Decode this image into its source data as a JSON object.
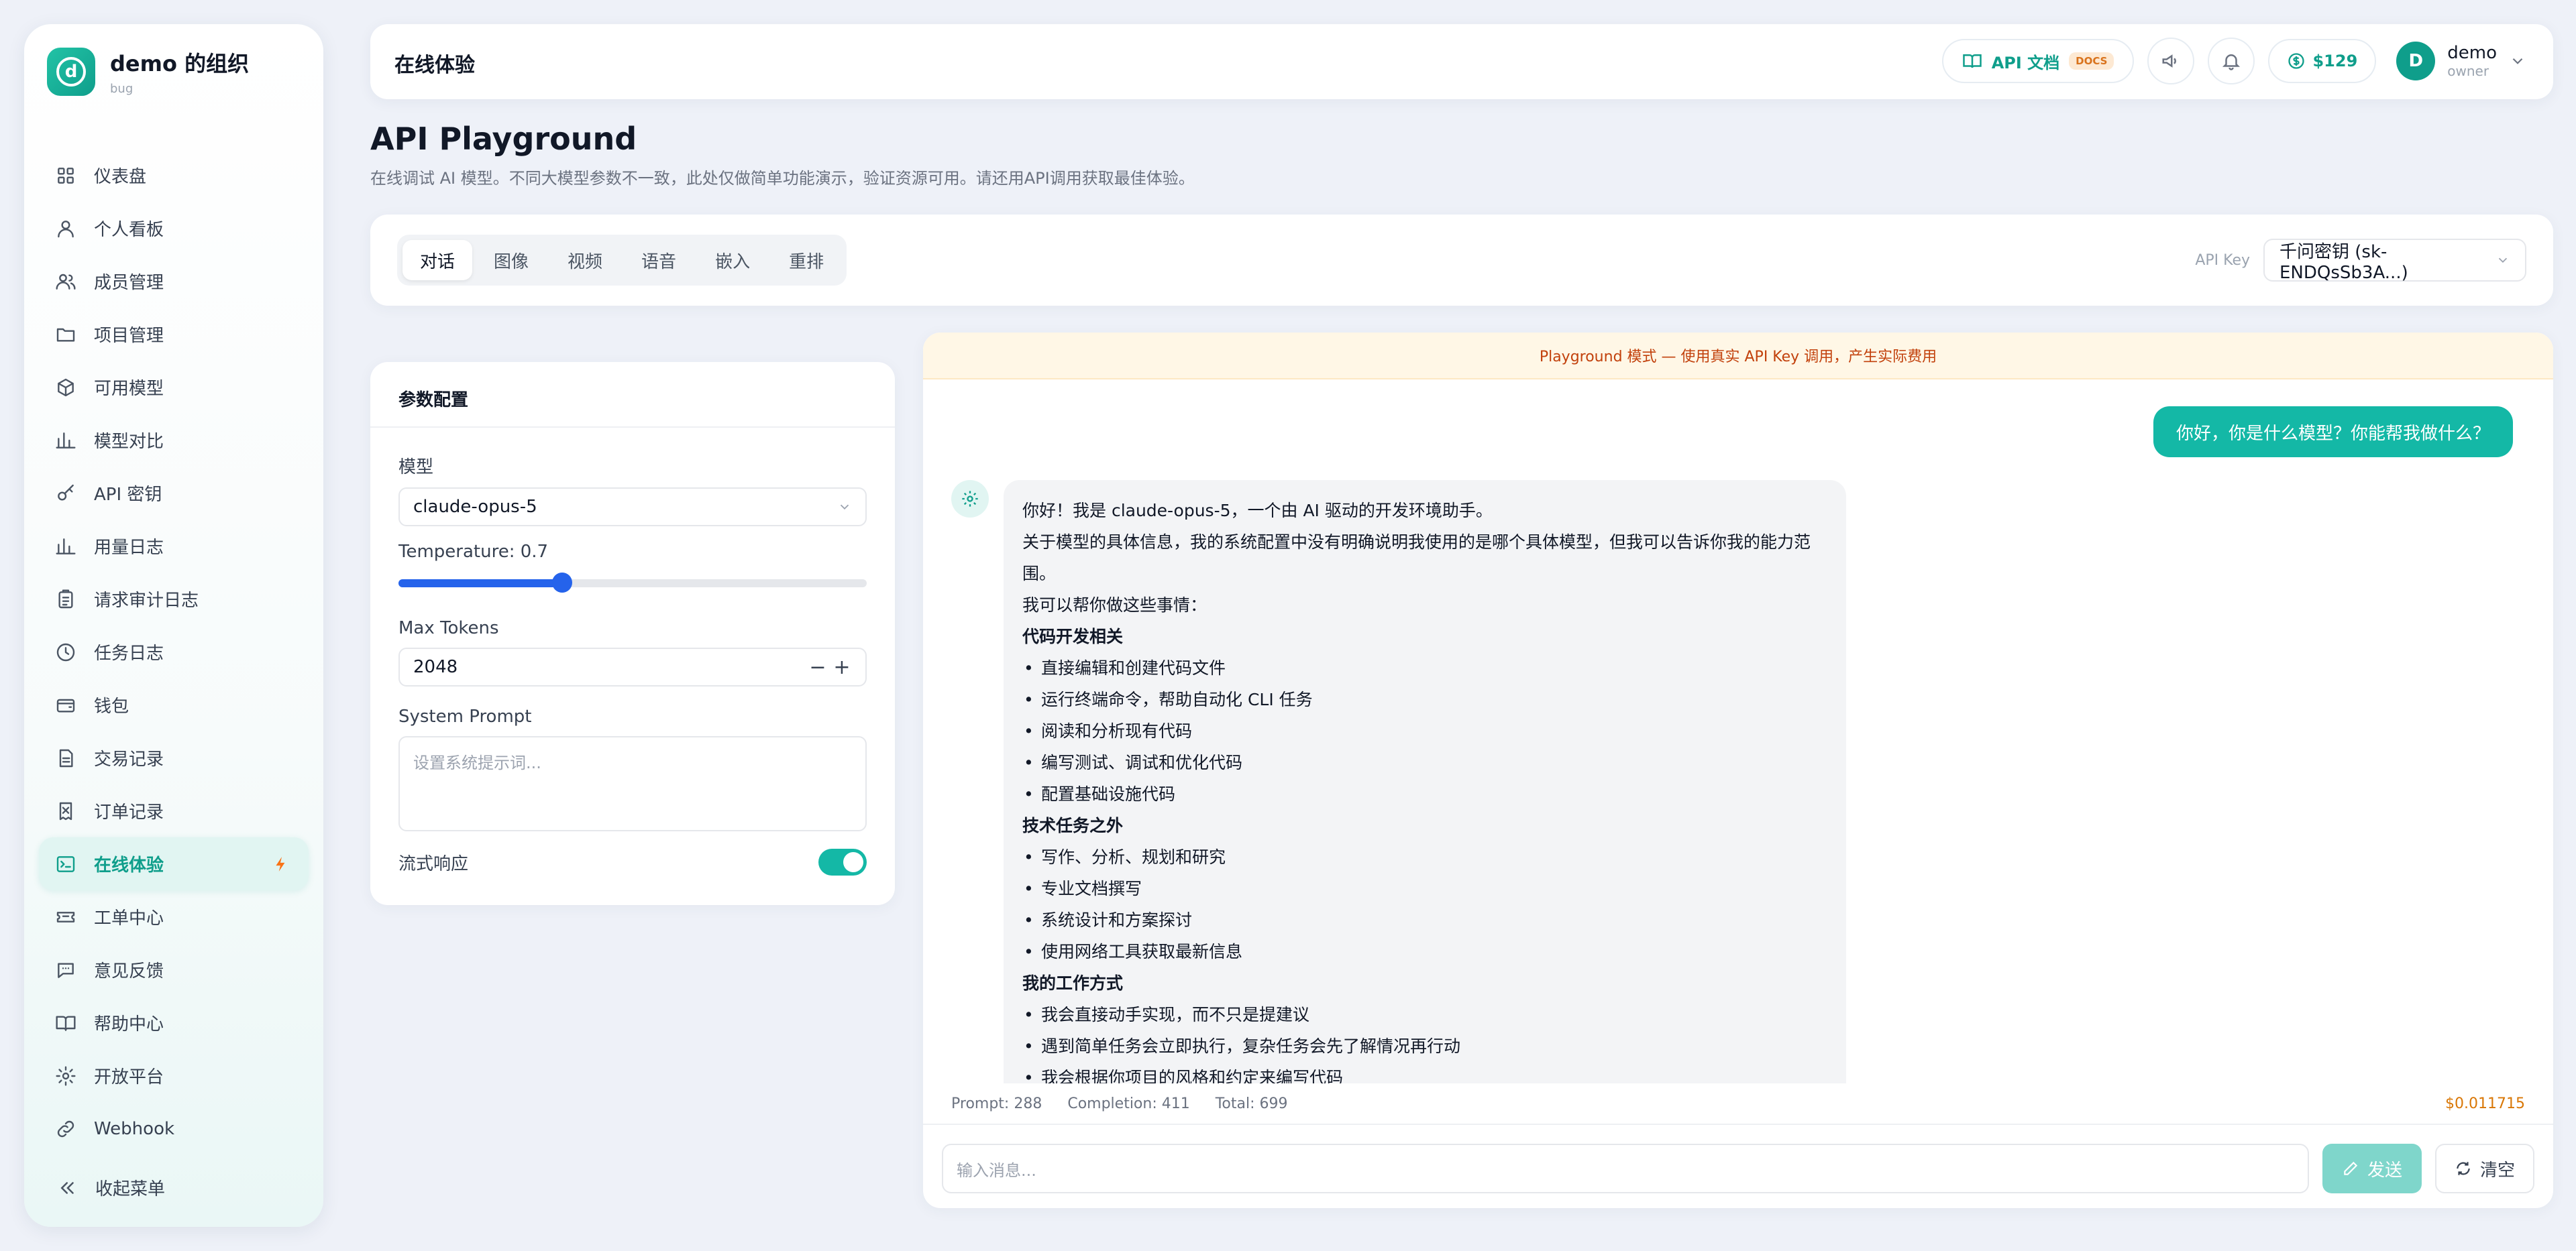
{
  "org": {
    "name": "demo 的组织",
    "subtitle": "bug",
    "logo_letter": "d"
  },
  "sidebar": {
    "items": [
      {
        "label": "仪表盘",
        "icon": "dashboard-icon"
      },
      {
        "label": "个人看板",
        "icon": "user-icon"
      },
      {
        "label": "成员管理",
        "icon": "users-icon"
      },
      {
        "label": "项目管理",
        "icon": "folder-icon"
      },
      {
        "label": "可用模型",
        "icon": "cube-icon"
      },
      {
        "label": "模型对比",
        "icon": "bar-chart-icon"
      },
      {
        "label": "API 密钥",
        "icon": "key-icon"
      },
      {
        "label": "用量日志",
        "icon": "bar-chart-icon"
      },
      {
        "label": "请求审计日志",
        "icon": "clipboard-icon"
      },
      {
        "label": "任务日志",
        "icon": "clock-icon"
      },
      {
        "label": "钱包",
        "icon": "wallet-icon"
      },
      {
        "label": "交易记录",
        "icon": "document-icon"
      },
      {
        "label": "订单记录",
        "icon": "receipt-icon"
      },
      {
        "label": "在线体验",
        "icon": "terminal-icon",
        "active": true
      },
      {
        "label": "工单中心",
        "icon": "ticket-icon"
      },
      {
        "label": "意见反馈",
        "icon": "chat-icon"
      },
      {
        "label": "帮助中心",
        "icon": "book-icon"
      },
      {
        "label": "开放平台",
        "icon": "gear-icon"
      },
      {
        "label": "Webhook",
        "icon": "link-icon"
      }
    ],
    "collapse_label": "收起菜单"
  },
  "header": {
    "title": "在线体验",
    "api_doc_label": "API 文档",
    "docs_badge": "DOCS",
    "balance": "$129",
    "user_initial": "D",
    "user_name": "demo",
    "user_role": "owner"
  },
  "page": {
    "title": "API Playground",
    "description": "在线调试 AI 模型。不同大模型参数不一致，此处仅做简单功能演示，验证资源可用。请还用API调用获取最佳体验。"
  },
  "tabs": [
    {
      "label": "对话",
      "active": true
    },
    {
      "label": "图像"
    },
    {
      "label": "视频"
    },
    {
      "label": "语音"
    },
    {
      "label": "嵌入"
    },
    {
      "label": "重排"
    }
  ],
  "api_key": {
    "label": "API Key",
    "selected": "千问密钥 (sk-ENDQsSb3A...)"
  },
  "params": {
    "heading": "参数配置",
    "model_label": "模型",
    "model_value": "claude-opus-5",
    "temperature_label": "Temperature: 0.7",
    "temperature_value": 0.7,
    "temperature_max": 2,
    "max_tokens_label": "Max Tokens",
    "max_tokens_value": "2048",
    "system_prompt_label": "System Prompt",
    "system_prompt_placeholder": "设置系统提示词...",
    "stream_label": "流式响应",
    "stream_on": true
  },
  "chat": {
    "banner": "Playground 模式 — 使用真实 API Key 调用，产生实际费用",
    "user_message": "你好，你是什么模型？你能帮我做什么？",
    "assistant_lines": [
      {
        "type": "p",
        "text": "你好！我是 claude-opus-5，一个由 AI 驱动的开发环境助手。"
      },
      {
        "type": "p",
        "text": "关于模型的具体信息，我的系统配置中没有明确说明我使用的是哪个具体模型，但我可以告诉你我的能力范围。"
      },
      {
        "type": "p",
        "text": "我可以帮你做这些事情："
      },
      {
        "type": "h",
        "text": "代码开发相关"
      },
      {
        "type": "li",
        "text": "直接编辑和创建代码文件"
      },
      {
        "type": "li",
        "text": "运行终端命令，帮助自动化 CLI 任务"
      },
      {
        "type": "li",
        "text": "阅读和分析现有代码"
      },
      {
        "type": "li",
        "text": "编写测试、调试和优化代码"
      },
      {
        "type": "li",
        "text": "配置基础设施代码"
      },
      {
        "type": "h",
        "text": "技术任务之外"
      },
      {
        "type": "li",
        "text": "写作、分析、规划和研究"
      },
      {
        "type": "li",
        "text": "专业文档撰写"
      },
      {
        "type": "li",
        "text": "系统设计和方案探讨"
      },
      {
        "type": "li",
        "text": "使用网络工具获取最新信息"
      },
      {
        "type": "h",
        "text": "我的工作方式"
      },
      {
        "type": "li",
        "text": "我会直接动手实现，而不只是提建议"
      },
      {
        "type": "li",
        "text": "遇到简单任务会立即执行，复杂任务会先了解情况再行动"
      },
      {
        "type": "li",
        "text": "我会根据你项目的风格和约定来编写代码"
      }
    ],
    "usage": {
      "prompt": "Prompt: 288",
      "completion": "Completion: 411",
      "total": "Total: 699",
      "cost": "$0.011715"
    },
    "input_placeholder": "输入消息...",
    "send_label": "发送",
    "clear_label": "清空"
  },
  "colors": {
    "accent": "#14b8a6",
    "accent_dark": "#0f9e8b",
    "slider": "#2563eb",
    "cost": "#d97706"
  }
}
